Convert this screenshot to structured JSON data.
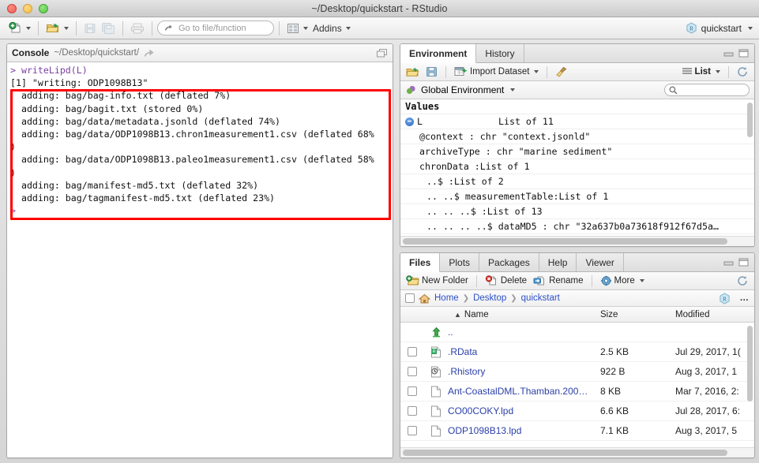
{
  "window": {
    "title": "~/Desktop/quickstart - RStudio",
    "traffic_lights": [
      "close",
      "minimize",
      "zoom"
    ]
  },
  "toolbar": {
    "new_file_label": "new-file",
    "open_label": "open-file",
    "save_label": "save",
    "save_all_label": "save-all",
    "print_label": "print",
    "goto_placeholder": "Go to file/function",
    "panes_label": "workspace-panes",
    "addins_label": "Addins",
    "project_label": "quickstart"
  },
  "console": {
    "title": "Console",
    "path": "~/Desktop/quickstart/",
    "lines": [
      {
        "type": "prompt",
        "text": "> writeLipd(L)"
      },
      {
        "type": "output",
        "text": "[1] \"writing: ODP1098B13\""
      },
      {
        "type": "output",
        "text": "  adding: bag/bag-info.txt (deflated 7%)"
      },
      {
        "type": "output",
        "text": "  adding: bag/bagit.txt (stored 0%)"
      },
      {
        "type": "output",
        "text": "  adding: bag/data/metadata.jsonld (deflated 74%)"
      },
      {
        "type": "output",
        "text": "  adding: bag/data/ODP1098B13.chron1measurement1.csv (deflated 68%"
      },
      {
        "type": "output",
        "text": ")"
      },
      {
        "type": "output",
        "text": "  adding: bag/data/ODP1098B13.paleo1measurement1.csv (deflated 58%"
      },
      {
        "type": "output",
        "text": ")"
      },
      {
        "type": "output",
        "text": "  adding: bag/manifest-md5.txt (deflated 32%)"
      },
      {
        "type": "output",
        "text": "  adding: bag/tagmanifest-md5.txt (deflated 23%)"
      },
      {
        "type": "prompt",
        "text": ">"
      }
    ],
    "highlight_color": "#ff0000"
  },
  "environment": {
    "tabs": [
      {
        "label": "Environment",
        "active": true
      },
      {
        "label": "History",
        "active": false
      }
    ],
    "toolbar": {
      "load_label": "load-workspace",
      "save_label": "save-workspace",
      "import_label": "Import Dataset",
      "clear_label": "clear-objects",
      "view_mode": "List",
      "refresh_label": "refresh"
    },
    "scope": "Global Environment",
    "search_placeholder": "",
    "section_label": "Values",
    "rows": [
      {
        "name": "L",
        "value": "List of 11",
        "expandable": true,
        "indent": 0
      },
      {
        "name": "",
        "value": "@context : chr \"context.jsonld\"",
        "expandable": false,
        "indent": 1
      },
      {
        "name": "",
        "value": "archiveType : chr \"marine sediment\"",
        "expandable": false,
        "indent": 1
      },
      {
        "name": "",
        "value": "chronData :List of 1",
        "expandable": false,
        "indent": 1
      },
      {
        "name": "",
        "value": "..$ :List of 2",
        "expandable": false,
        "indent": 2
      },
      {
        "name": "",
        "value": ".. ..$ measurementTable:List of 1",
        "expandable": false,
        "indent": 2
      },
      {
        "name": "",
        "value": ".. .. ..$ :List of 13",
        "expandable": false,
        "indent": 2
      },
      {
        "name": "",
        "value": ".. .. .. ..$ dataMD5 : chr \"32a637b0a73618f912f67d5a…",
        "expandable": false,
        "indent": 2
      }
    ]
  },
  "files": {
    "tabs": [
      {
        "label": "Files",
        "active": true
      },
      {
        "label": "Plots",
        "active": false
      },
      {
        "label": "Packages",
        "active": false
      },
      {
        "label": "Help",
        "active": false
      },
      {
        "label": "Viewer",
        "active": false
      }
    ],
    "toolbar": {
      "new_folder_label": "New Folder",
      "delete_label": "Delete",
      "rename_label": "Rename",
      "more_label": "More",
      "refresh_label": "refresh"
    },
    "breadcrumb": [
      "Home",
      "Desktop",
      "quickstart"
    ],
    "more_button_label": "…",
    "columns": [
      "Name",
      "Size",
      "Modified"
    ],
    "sort_column": "Name",
    "sort_direction": "asc",
    "rows": [
      {
        "name": "..",
        "size": "",
        "modified": "",
        "icon": "up-folder-icon",
        "checkbox": false
      },
      {
        "name": ".RData",
        "size": "2.5 KB",
        "modified": "Jul 29, 2017, 1(",
        "icon": "rdata-icon",
        "checkbox": true
      },
      {
        "name": ".Rhistory",
        "size": "922 B",
        "modified": "Aug 3, 2017, 1",
        "icon": "rhistory-icon",
        "checkbox": true
      },
      {
        "name": "Ant-CoastalDML.Thamban.200…",
        "size": "8 KB",
        "modified": "Mar 7, 2016, 2:",
        "icon": "file-icon",
        "checkbox": true
      },
      {
        "name": "CO00COKY.lpd",
        "size": "6.6 KB",
        "modified": "Jul 28, 2017, 6:",
        "icon": "file-icon",
        "checkbox": true
      },
      {
        "name": "ODP1098B13.lpd",
        "size": "7.1 KB",
        "modified": "Aug 3, 2017, 5",
        "icon": "file-icon",
        "checkbox": true
      }
    ]
  }
}
